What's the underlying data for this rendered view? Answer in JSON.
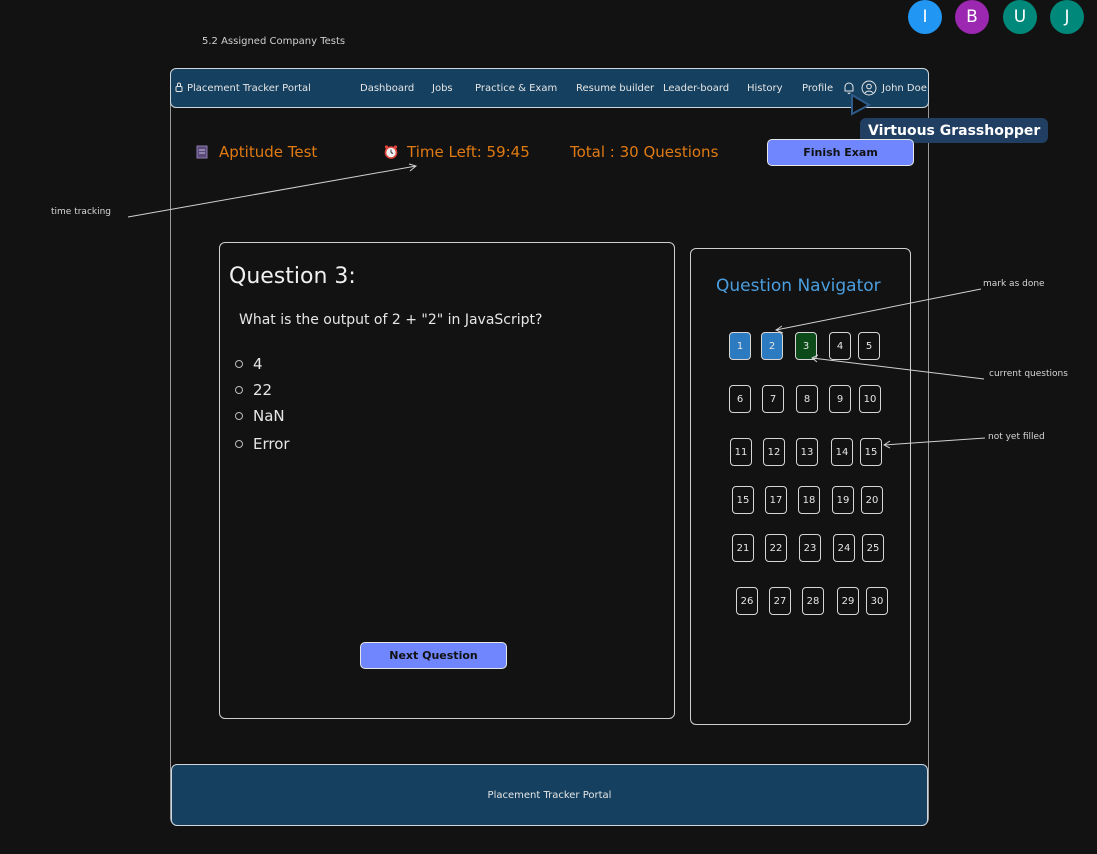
{
  "frame_title": "5.2 Assigned Company Tests",
  "collaborators": [
    {
      "initial": "I",
      "color": "#2196f3"
    },
    {
      "initial": "B",
      "color": "#9c27b0"
    },
    {
      "initial": "U",
      "color": "#00897b"
    },
    {
      "initial": "J",
      "color": "#00897b"
    }
  ],
  "navbar": {
    "brand": "Placement Tracker Portal",
    "links": [
      "Dashboard",
      "Jobs",
      "Practice & Exam",
      "Resume builder",
      "Leader-board",
      "History",
      "Profile"
    ],
    "user_name": "John Doe",
    "icons": [
      "lock-icon",
      "bell-icon",
      "user-icon"
    ]
  },
  "cursor_label": "Virtuous Grasshopper",
  "exam_header": {
    "title": "Aptitude Test",
    "timer": "Time Left: 59:45",
    "total": "Total : 30 Questions",
    "finish_label": "Finish Exam"
  },
  "question": {
    "heading": "Question 3:",
    "text": "What is the output of 2 + \"2\" in JavaScript?",
    "options": [
      "4",
      "22",
      "NaN",
      "Error"
    ],
    "next_label": "Next Question"
  },
  "navigator": {
    "title": "Question Navigator",
    "rows": [
      [
        "1",
        "2",
        "3",
        "4",
        "5"
      ],
      [
        "6",
        "7",
        "8",
        "9",
        "10"
      ],
      [
        "11",
        "12",
        "13",
        "14",
        "15"
      ],
      [
        "15",
        "17",
        "18",
        "19",
        "20"
      ],
      [
        "21",
        "22",
        "23",
        "24",
        "25"
      ],
      [
        "26",
        "27",
        "28",
        "29",
        "30"
      ]
    ],
    "done": [
      "1",
      "2"
    ],
    "current": "3",
    "colors": {
      "done": "#2c7ac0",
      "current": "#0c4a1a"
    }
  },
  "annotations": {
    "time_tracking": "time tracking",
    "mark_as_done": "mark as done",
    "current_questions": "current questions",
    "not_yet_filled": "not yet filled"
  },
  "footer": {
    "text": "Placement Tracker Portal"
  }
}
